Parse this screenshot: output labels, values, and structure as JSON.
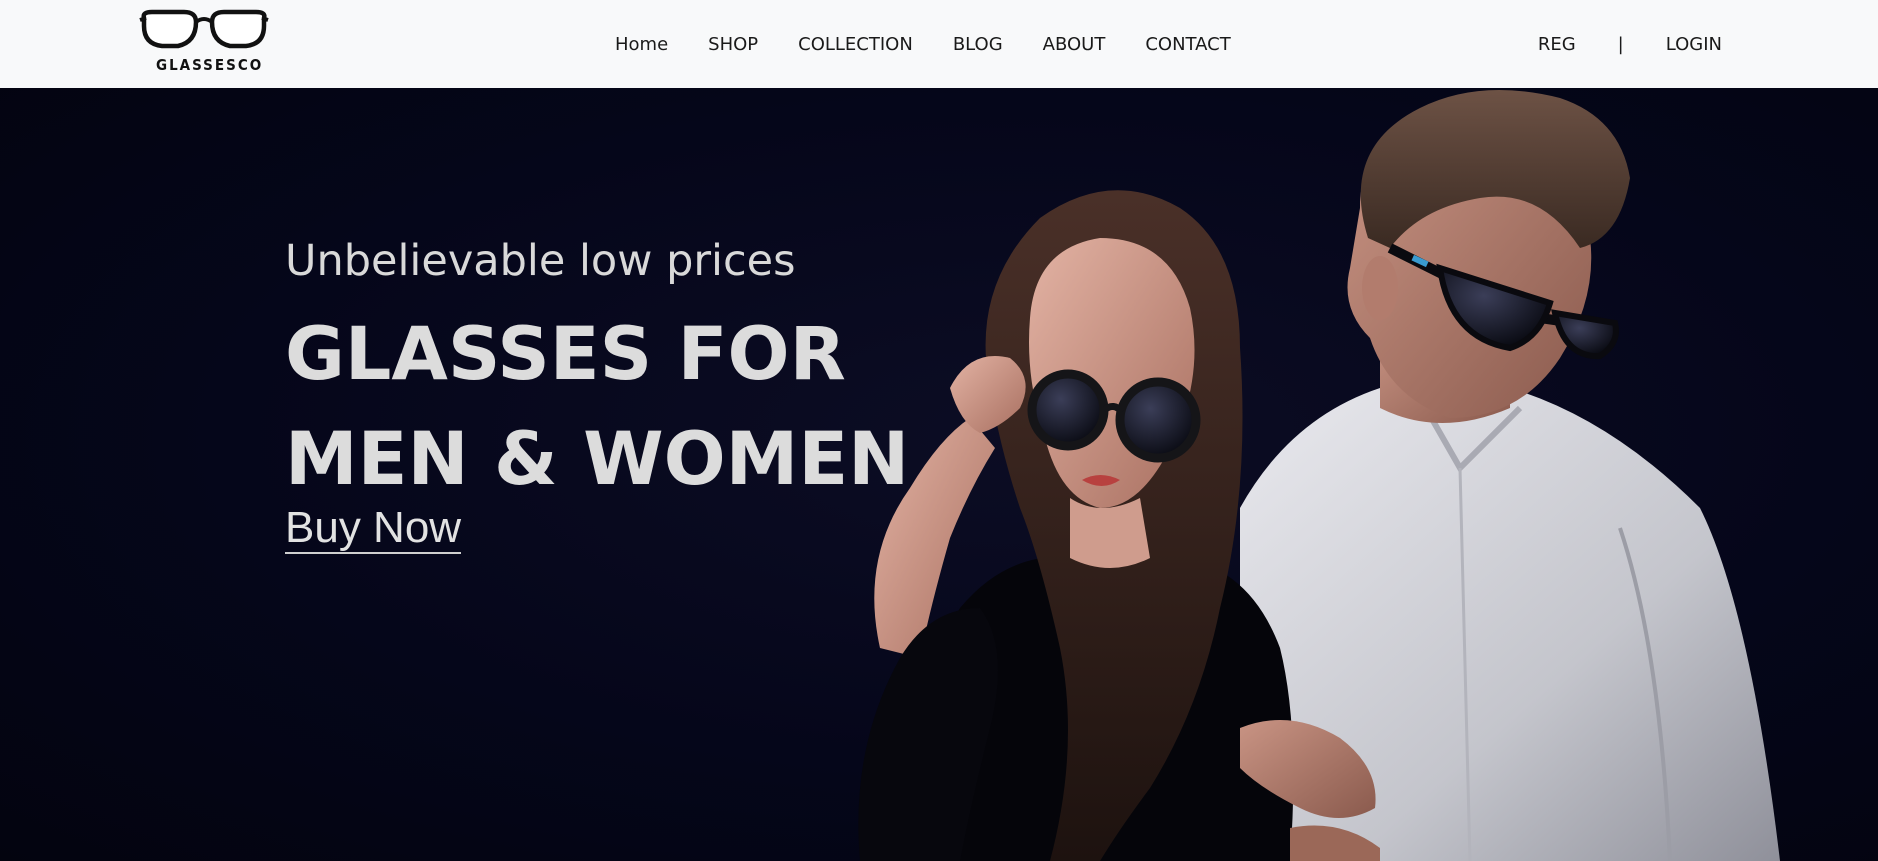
{
  "header": {
    "logo_text": "GLASSESCO",
    "nav": [
      {
        "label": "Home"
      },
      {
        "label": "SHOP"
      },
      {
        "label": "COLLECTION"
      },
      {
        "label": "BLOG"
      },
      {
        "label": "ABOUT"
      },
      {
        "label": "CONTACT"
      }
    ],
    "auth": {
      "register_label": "REG",
      "separator": "|",
      "login_label": "LOGIN"
    }
  },
  "hero": {
    "tagline": "Unbelievable low prices",
    "title_line1": "GLASSES FOR",
    "title_line2": "MEN & WOMEN",
    "cta_label": "Buy Now"
  },
  "colors": {
    "header_bg": "#f8f9fa",
    "hero_bg": "#05061a",
    "hero_text": "#dcdcdc"
  },
  "icons": {
    "logo": "glasses-icon"
  }
}
